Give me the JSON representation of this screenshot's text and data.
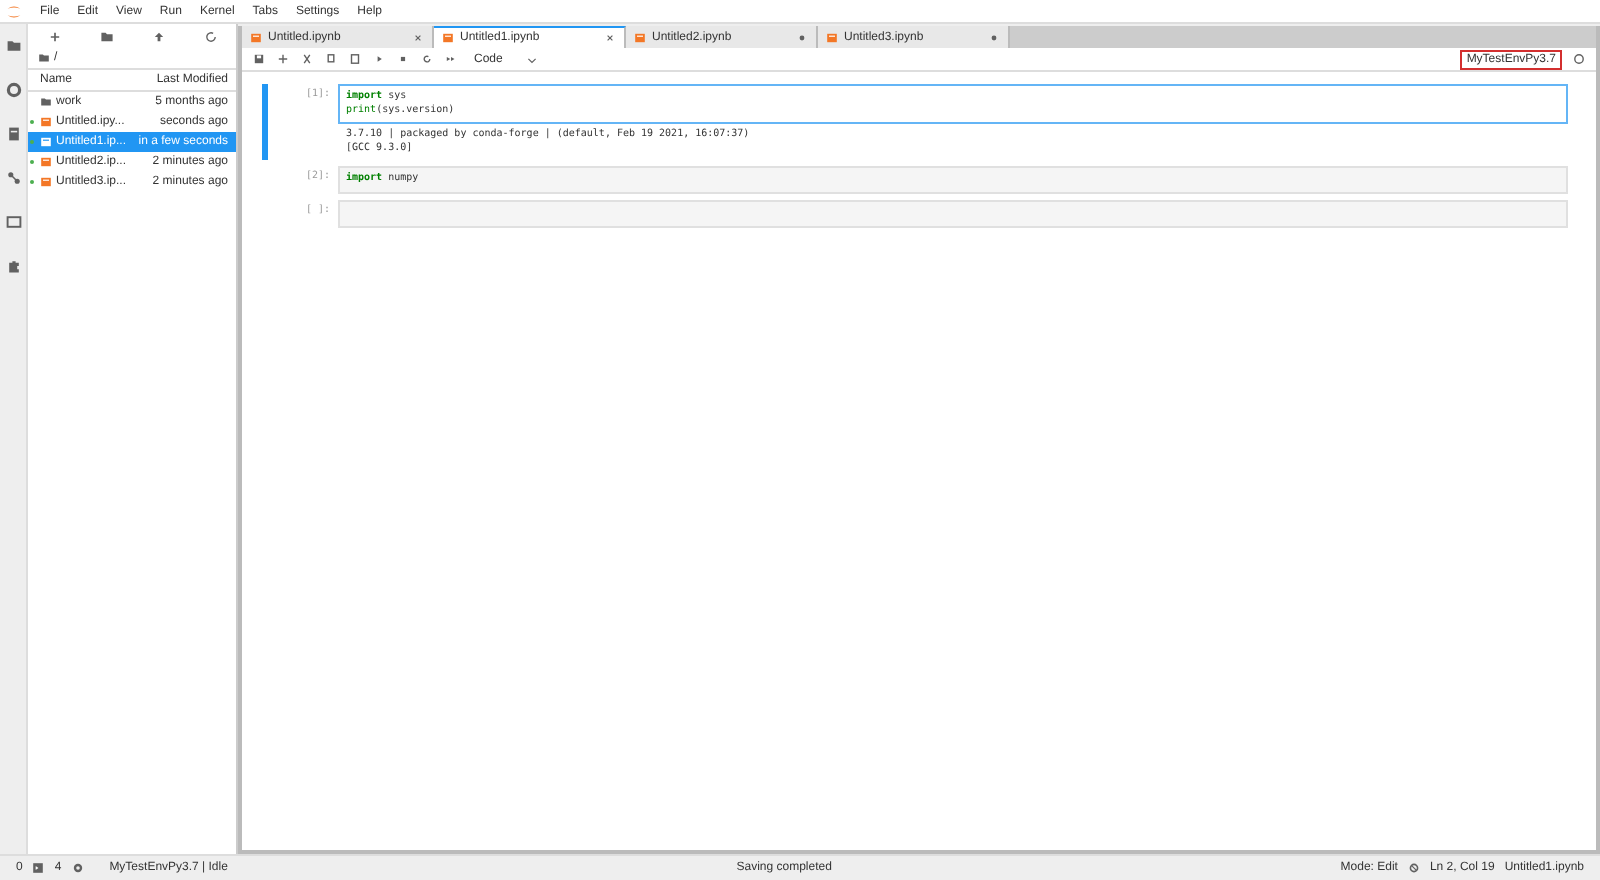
{
  "menu": [
    "File",
    "Edit",
    "View",
    "Run",
    "Kernel",
    "Tabs",
    "Settings",
    "Help"
  ],
  "file_browser": {
    "path": "/",
    "columns": [
      "Name",
      "Last Modified"
    ],
    "items": [
      {
        "name": "work",
        "modified": "5 months ago",
        "kind": "folder",
        "running": false,
        "selected": false
      },
      {
        "name": "Untitled.ipy...",
        "modified": "seconds ago",
        "kind": "notebook",
        "running": true,
        "selected": false
      },
      {
        "name": "Untitled1.ip...",
        "modified": "in a few seconds",
        "kind": "notebook",
        "running": true,
        "selected": true
      },
      {
        "name": "Untitled2.ip...",
        "modified": "2 minutes ago",
        "kind": "notebook",
        "running": true,
        "selected": false
      },
      {
        "name": "Untitled3.ip...",
        "modified": "2 minutes ago",
        "kind": "notebook",
        "running": true,
        "selected": false
      }
    ]
  },
  "tabs": [
    {
      "label": "Untitled.ipynb",
      "selected": false,
      "kind": "close"
    },
    {
      "label": "Untitled1.ipynb",
      "selected": true,
      "kind": "close"
    },
    {
      "label": "Untitled2.ipynb",
      "selected": false,
      "kind": "dirty"
    },
    {
      "label": "Untitled3.ipynb",
      "selected": false,
      "kind": "dirty"
    }
  ],
  "toolbar": {
    "cell_type": "Code",
    "kernel": "MyTestEnvPy3.7"
  },
  "cells": [
    {
      "prompt": "[1]:",
      "active": true,
      "lines": [
        [
          {
            "text": "import",
            "kind": "keyword"
          },
          {
            "text": " sys",
            "kind": "name"
          }
        ],
        [
          {
            "text": "print",
            "kind": "builtin"
          },
          {
            "text": "(sys.version)",
            "kind": "name"
          }
        ]
      ],
      "output": [
        "3.7.10 | packaged by conda-forge | (default, Feb 19 2021, 16:07:37)",
        "[GCC 9.3.0]"
      ]
    },
    {
      "prompt": "[2]:",
      "active": false,
      "lines": [
        [
          {
            "text": "import",
            "kind": "keyword"
          },
          {
            "text": " numpy",
            "kind": "name"
          }
        ]
      ]
    },
    {
      "prompt": "[ ]:",
      "active": false
    }
  ],
  "status_bar": {
    "cell_count": "0",
    "terminal_count": "4",
    "kernel_status": "MyTestEnvPy3.7 | Idle",
    "message": "Saving completed",
    "mode": "Mode: Edit",
    "position": "Ln 2, Col 19",
    "file": "Untitled1.ipynb"
  }
}
